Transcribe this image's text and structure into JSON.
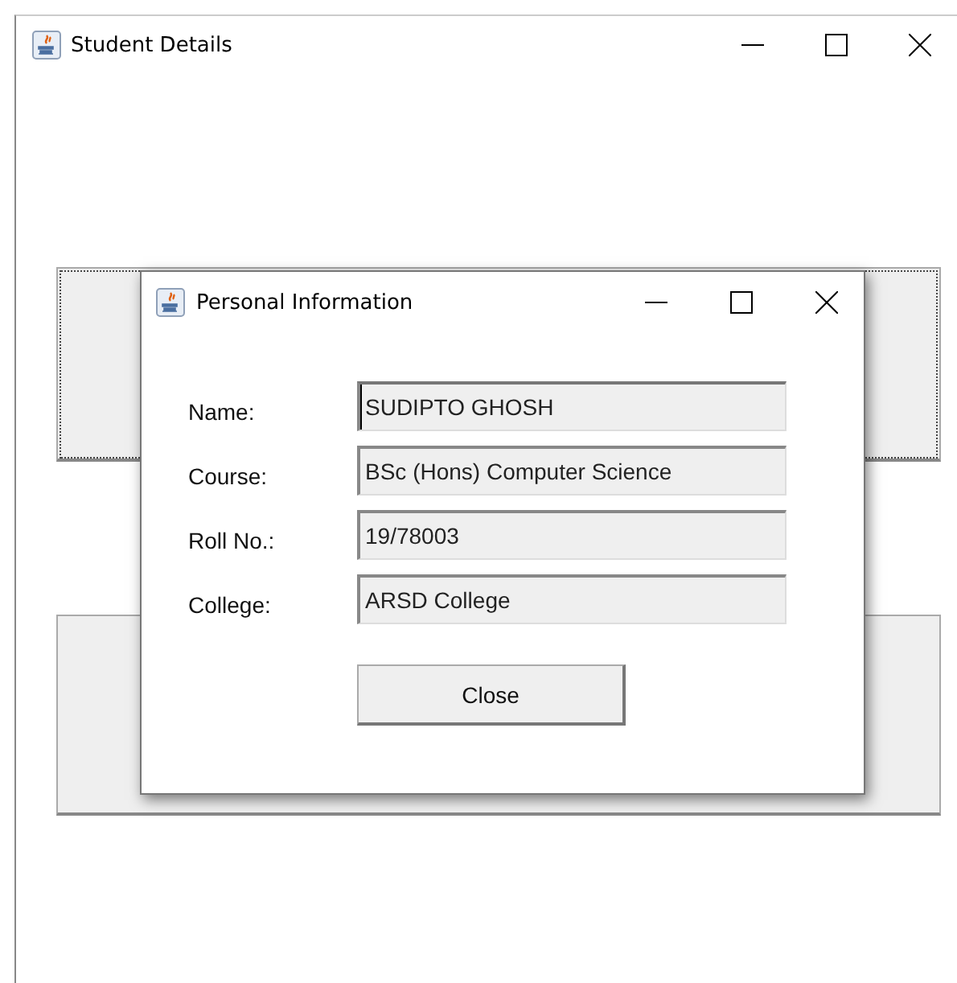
{
  "window": {
    "title": "Student Details"
  },
  "dialog": {
    "title": "Personal Information",
    "fields": [
      {
        "label": "Name:",
        "value": "SUDIPTO GHOSH",
        "focused": true
      },
      {
        "label": "Course:",
        "value": "BSc (Hons) Computer Science",
        "focused": false
      },
      {
        "label": "Roll No.:",
        "value": "19/78003",
        "focused": false
      },
      {
        "label": "College:",
        "value": "ARSD College",
        "focused": false
      }
    ],
    "button": "Close"
  }
}
